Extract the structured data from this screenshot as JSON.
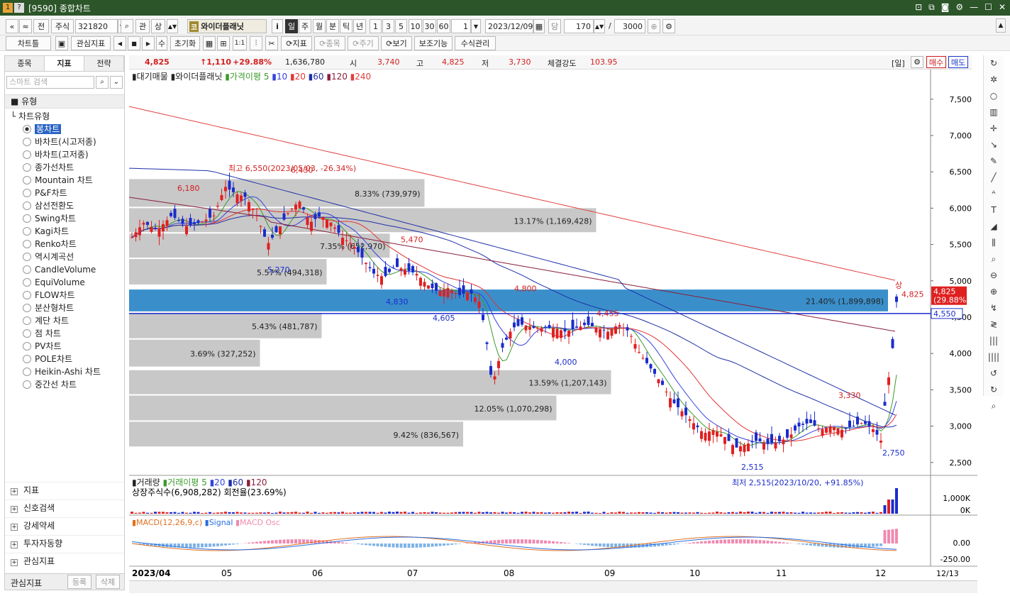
{
  "window": {
    "title": "[9590] 종합차트",
    "icon1": "1",
    "icon2": "?",
    "controls": [
      "pin-icon",
      "restore-icon",
      "camera-icon",
      "gear-icon",
      "minimize-icon",
      "maximize-icon",
      "close-icon"
    ]
  },
  "toolbar1": {
    "nav_first": "«",
    "nav_up": "≈",
    "prev": "전",
    "type": "주식",
    "code": "321820",
    "lookup": "관",
    "up": "상",
    "stock_badge": "코",
    "stock_name": "와이더플래닛",
    "info": "i",
    "periods": [
      "일",
      "주",
      "월",
      "분",
      "틱",
      "년"
    ],
    "nums": [
      "1",
      "3",
      "5",
      "10",
      "30",
      "60"
    ],
    "count_sel": "1",
    "date": "2023/12/09",
    "cal": "당",
    "view_count": "170",
    "total": "3000",
    "slash": "/"
  },
  "toolbar2": {
    "chart_tab": "차트틀",
    "fav": "관심지표",
    "su": "수",
    "reset": "초기화",
    "one": "1:1",
    "indicator": "지표",
    "item": "종목",
    "cycle": "주기",
    "view": "보기",
    "aux": "보조기능",
    "formula": "수식관리"
  },
  "left": {
    "tabs": [
      "종목",
      "지표",
      "전략"
    ],
    "search_placeholder": "스마트 검색",
    "section": "유형",
    "tree_group": "차트유형",
    "items": [
      "봉차트",
      "바차트(시고저종)",
      "바차트(고저종)",
      "종가선차트",
      "Mountain 차트",
      "P&F차트",
      "삼선전환도",
      "Swing차트",
      "Kagi차트",
      "Renko차트",
      "역시계곡선",
      "CandleVolume",
      "EquiVolume",
      "FLOW차트",
      "분산형차트",
      "계단 차트",
      "점 차트",
      "PV차트",
      "POLE차트",
      "Heikin-Ashi 차트",
      "중간선 차트"
    ],
    "selected": "봉차트",
    "footer": [
      "지표",
      "신호검색",
      "강세약세",
      "투자자동향",
      "관심지표"
    ],
    "bottom_label": "관심지표",
    "bottom_btn1": "등록",
    "bottom_btn2": "삭제"
  },
  "quote": {
    "price": "4,825",
    "change": "↑1,110",
    "rate": "+29.88%",
    "volume": "1,636,780",
    "open_label": "시",
    "open": "3,740",
    "high_label": "고",
    "high": "4,825",
    "low_label": "저",
    "low": "3,730",
    "strength_label": "체결강도",
    "strength": "103.95",
    "period_tag": "[일]",
    "buy": "매수",
    "sell": "매도"
  },
  "legend": {
    "main": "대기매물",
    "name": "와이더플래닛",
    "ma_label": "가격이평",
    "ma": [
      "5",
      "10",
      "20",
      "60",
      "120",
      "240"
    ],
    "vol": "거래량",
    "vol_ma_label": "거래이평",
    "vol_ma": [
      "5",
      "20",
      "60",
      "120"
    ],
    "listed": "상장주식수(6,908,282) 회전율(23.69%)",
    "macd": "MACD(12,26,9,c)",
    "signal": "Signal",
    "osc": "MACD Osc"
  },
  "colors": {
    "up": "#e02020",
    "down": "#1a2ccc",
    "ma5": "#3a9a2a",
    "ma10": "#3344dd",
    "ma20": "#e23535",
    "ma60": "#1f2fa8",
    "ma120": "#8a1f3a",
    "ma240": "#e04040",
    "profile": "#c8c8c8",
    "profile_hl": "#3a8fcb"
  },
  "chart_data": {
    "type": "candlestick",
    "x_ticks": [
      "2023/04",
      "05",
      "06",
      "07",
      "08",
      "09",
      "10",
      "11",
      "12",
      "12/13"
    ],
    "y_ticks": [
      "7,500",
      "7,000",
      "6,500",
      "6,000",
      "5,500",
      "5,000",
      "4,500",
      "4,000",
      "3,500",
      "3,000",
      "2,500"
    ],
    "ylim": [
      2400,
      7800
    ],
    "annotations": [
      "최고 6,550(2023/05/03, -26.34%)",
      "최저 2,515(2023/10/20, +91.85%)",
      "6,180",
      "6,430",
      "5,470",
      "5,270",
      "4,830",
      "4,605",
      "4,800",
      "4,455",
      "4,000",
      "3,330",
      "2,750",
      "2,515",
      "4,825",
      "상"
    ],
    "last_price": "4,825",
    "last_rate": "(29.88%)",
    "cursor_price": "4,550",
    "volume_profile": [
      {
        "label": "8.33% (739,979)",
        "lo": 6000,
        "hi": 6400
      },
      {
        "label": "13.17% (1,169,428)",
        "lo": 5650,
        "hi": 6000
      },
      {
        "label": "7.35% (652,970)",
        "lo": 5300,
        "hi": 5650
      },
      {
        "label": "5.57% (494,318)",
        "lo": 4930,
        "hi": 5300
      },
      {
        "label": "21.40% (1,899,898)",
        "lo": 4560,
        "hi": 4880
      },
      {
        "label": "5.43% (481,787)",
        "lo": 4190,
        "hi": 4560
      },
      {
        "label": "3.69% (327,252)",
        "lo": 3800,
        "hi": 4190
      },
      {
        "label": "13.59% (1,207,143)",
        "lo": 3420,
        "hi": 3770
      },
      {
        "label": "12.05% (1,070,298)",
        "lo": 3060,
        "hi": 3420
      },
      {
        "label": "9.42% (836,567)",
        "lo": 2700,
        "hi": 3060
      }
    ],
    "volume_ticks": [
      "1,000K",
      "0K"
    ],
    "macd_ticks": [
      "0.00",
      "-250.00"
    ],
    "bottom_right": "12/13"
  }
}
